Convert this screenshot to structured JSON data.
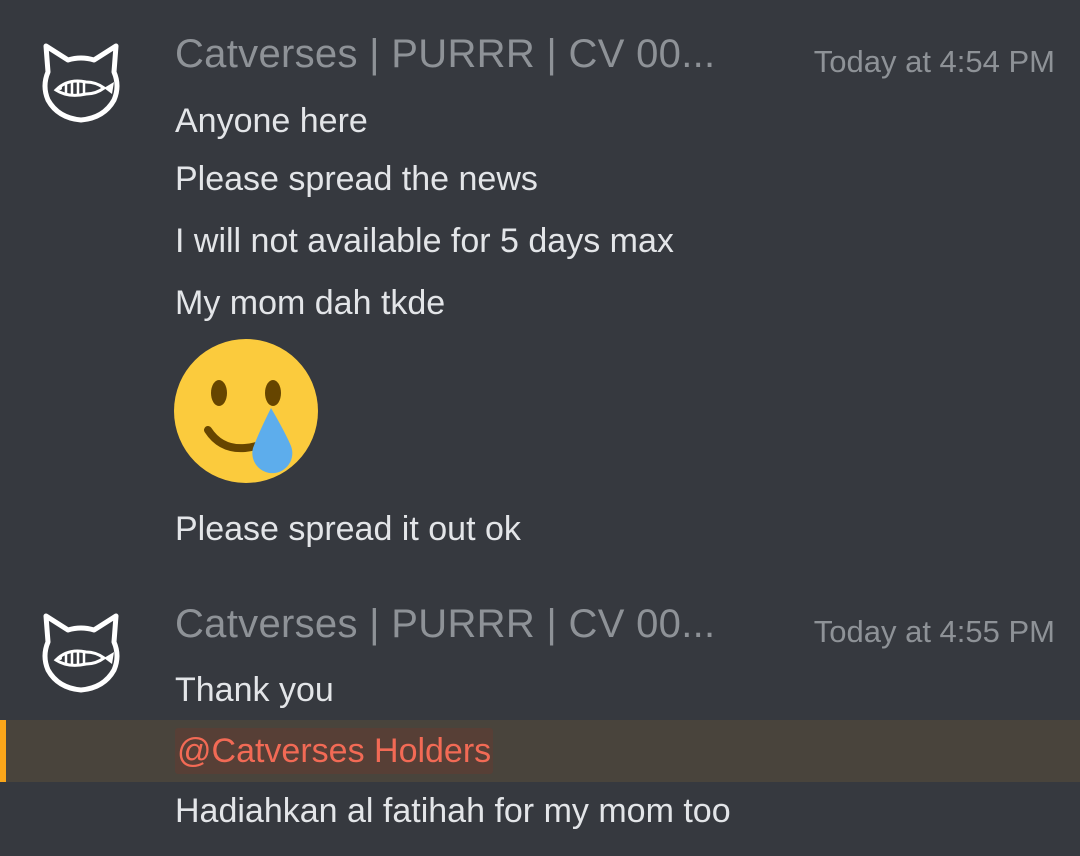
{
  "messages": [
    {
      "author": "Catverses | PURRR | CV 00...",
      "timestamp": "Today at 4:54 PM",
      "lines": [
        "Anyone here",
        "Please spread the news",
        "I will not available for 5 days max",
        "My mom dah tkde"
      ],
      "emoji": "smiling-face-with-tear-emoji",
      "after_emoji": "Please spread it out ok"
    },
    {
      "author": "Catverses | PURRR | CV 00...",
      "timestamp": "Today at 4:55 PM",
      "lines": [
        "Thank you"
      ],
      "mention": "@Catverses Holders",
      "after_mention": "Hadiahkan al fatihah for my mom too"
    }
  ],
  "colors": {
    "background": "#36393f",
    "mention_highlight": "#49443c",
    "mention_bar": "#faa61a",
    "mention_text": "#f26a55"
  }
}
